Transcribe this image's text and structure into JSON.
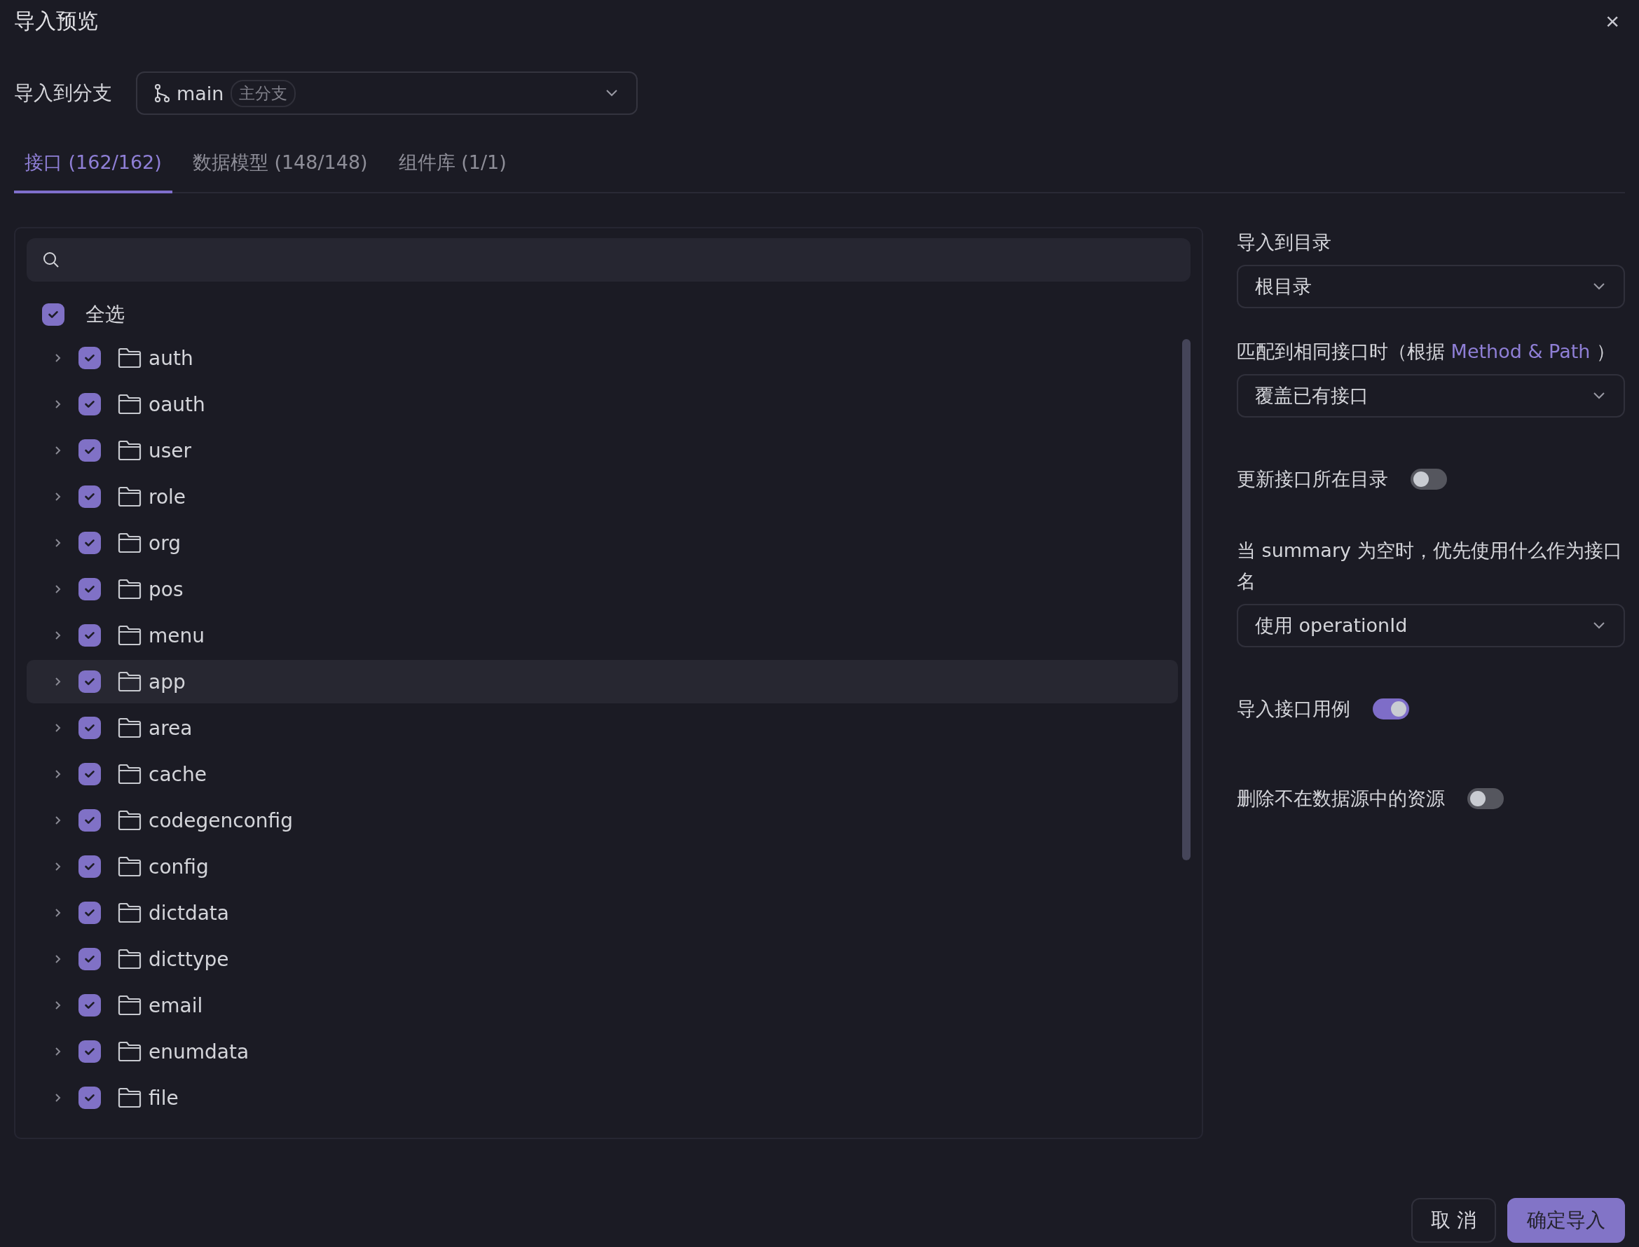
{
  "dialog": {
    "title": "导入预览",
    "close": "×"
  },
  "branch": {
    "label": "导入到分支",
    "value": "main",
    "tag": "主分支"
  },
  "tabs": [
    {
      "label": "接口 (162/162)",
      "selected": true
    },
    {
      "label": "数据模型 (148/148)",
      "selected": false
    },
    {
      "label": "组件库 (1/1)",
      "selected": false
    }
  ],
  "tree": {
    "select_all": {
      "label": "全选",
      "checked": true
    },
    "items": [
      {
        "label": "auth",
        "checked": true,
        "expanded": false,
        "hovered": false
      },
      {
        "label": "oauth",
        "checked": true,
        "expanded": false,
        "hovered": false
      },
      {
        "label": "user",
        "checked": true,
        "expanded": false,
        "hovered": false
      },
      {
        "label": "role",
        "checked": true,
        "expanded": false,
        "hovered": false
      },
      {
        "label": "org",
        "checked": true,
        "expanded": false,
        "hovered": false
      },
      {
        "label": "pos",
        "checked": true,
        "expanded": false,
        "hovered": false
      },
      {
        "label": "menu",
        "checked": true,
        "expanded": false,
        "hovered": false
      },
      {
        "label": "app",
        "checked": true,
        "expanded": false,
        "hovered": true
      },
      {
        "label": "area",
        "checked": true,
        "expanded": false,
        "hovered": false
      },
      {
        "label": "cache",
        "checked": true,
        "expanded": false,
        "hovered": false
      },
      {
        "label": "codegenconfig",
        "checked": true,
        "expanded": false,
        "hovered": false
      },
      {
        "label": "config",
        "checked": true,
        "expanded": false,
        "hovered": false
      },
      {
        "label": "dictdata",
        "checked": true,
        "expanded": false,
        "hovered": false
      },
      {
        "label": "dicttype",
        "checked": true,
        "expanded": false,
        "hovered": false
      },
      {
        "label": "email",
        "checked": true,
        "expanded": false,
        "hovered": false
      },
      {
        "label": "enumdata",
        "checked": true,
        "expanded": false,
        "hovered": false
      },
      {
        "label": "file",
        "checked": true,
        "expanded": false,
        "hovered": false
      }
    ]
  },
  "settings": [
    {
      "kind": "select",
      "label": "导入到目录",
      "value": "根目录"
    },
    {
      "kind": "select",
      "label": "匹配到相同接口时（根据",
      "link": "Method & Path",
      "label_end": "）",
      "value": "覆盖已有接口"
    },
    {
      "kind": "toggle",
      "label": "更新接口所在目录",
      "on": false
    },
    {
      "kind": "select",
      "label": "当 summary 为空时，优先使用什么作为接口名",
      "value": "使用 operationId"
    },
    {
      "kind": "toggle",
      "label": "导入接口用例",
      "on": true
    },
    {
      "kind": "toggle",
      "label": "删除不在数据源中的资源",
      "on": false
    }
  ],
  "buttons": [
    {
      "label": "取 消",
      "primary": false
    },
    {
      "label": "确定导入",
      "primary": true
    }
  ]
}
